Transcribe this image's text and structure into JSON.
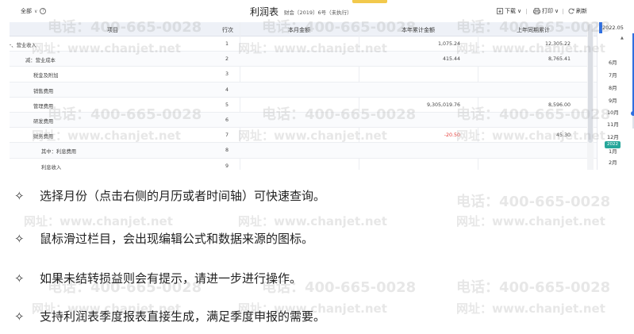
{
  "toolbar": {
    "scope_label": "全部",
    "title": "利润表",
    "subtitle": "财会〔2019〕6号（未执行）",
    "download_label": "下载",
    "print_label": "打印",
    "refresh_label": "刷新"
  },
  "table": {
    "headers": [
      "项目",
      "行次",
      "本月金额",
      "本年累计金额",
      "上年同期累计"
    ],
    "rows": [
      {
        "item": "一、营业收入",
        "line": "1",
        "month": "",
        "ytd": "1,075.24",
        "prev": "12,305.22"
      },
      {
        "item": "减：营业成本",
        "line": "2",
        "month": "",
        "ytd": "415.44",
        "prev": "8,765.41"
      },
      {
        "item": "税金及附加",
        "line": "3",
        "month": "",
        "ytd": "",
        "prev": ""
      },
      {
        "item": "销售费用",
        "line": "4",
        "month": "",
        "ytd": "",
        "prev": ""
      },
      {
        "item": "管理费用",
        "line": "5",
        "month": "",
        "ytd": "9,305,019.76",
        "prev": "8,596.00"
      },
      {
        "item": "研发费用",
        "line": "6",
        "month": "",
        "ytd": "",
        "prev": ""
      },
      {
        "item": "财务费用",
        "line": "7",
        "month": "",
        "ytd": "-20.50",
        "prev": "45.30"
      },
      {
        "item": "其中：利息费用",
        "line": "8",
        "month": "",
        "ytd": "",
        "prev": ""
      },
      {
        "item": "利息收入",
        "line": "9",
        "month": "",
        "ytd": "",
        "prev": ""
      }
    ]
  },
  "timeline": {
    "year_label": "2022.05",
    "months": [
      "6月",
      "7月",
      "8月",
      "9月",
      "10月",
      "11月",
      "12月",
      "1月",
      "2月"
    ],
    "badge": "2022"
  },
  "watermark": {
    "phone": "电话：400-665-0028",
    "url": "网址：www.chanjet.net"
  },
  "bullets": [
    {
      "mark": "✧",
      "text": "选择月份（点击右侧的月历或者时间轴）可快速查询。"
    },
    {
      "mark": "✧",
      "text": "鼠标滑过栏目，会出现编辑公式和数据来源的图标。"
    },
    {
      "mark": "✧",
      "text": "如果未结转损益则会有提示，请进一步进行操作。"
    },
    {
      "mark": "✧",
      "text": "支持利润表季度报表直接生成，满足季度申报的需要。"
    }
  ],
  "colors": {
    "accent": "#2f6fe0",
    "negative": "#e53935",
    "badge": "#26a69a"
  }
}
